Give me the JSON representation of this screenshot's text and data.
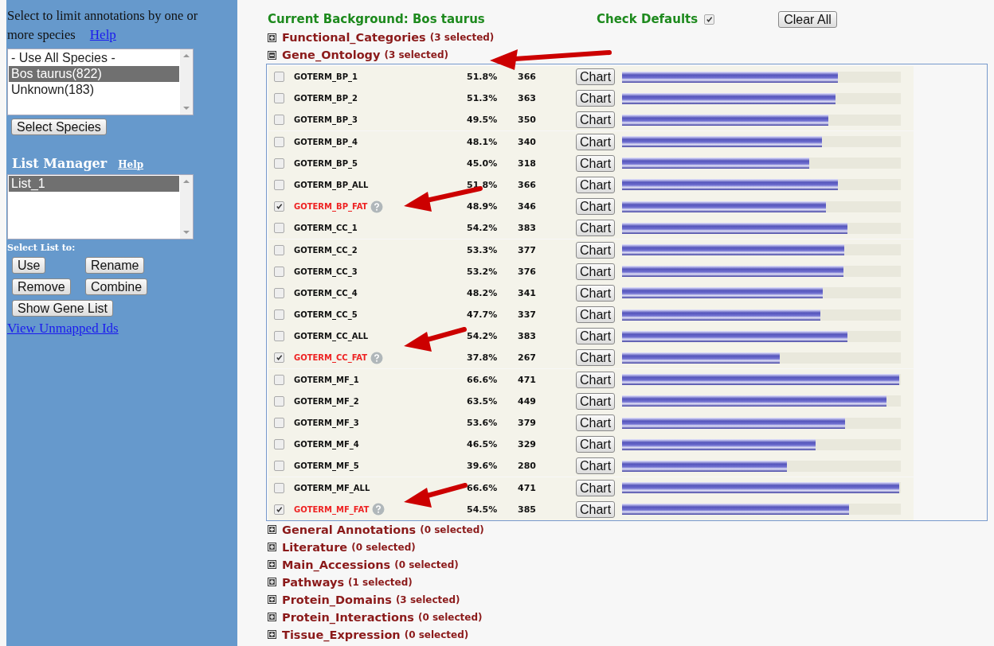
{
  "sidebar": {
    "species_prompt": "Select to limit annotations by one or more species",
    "species_help": "Help",
    "species_list": [
      {
        "label": "- Use All Species -",
        "selected": false
      },
      {
        "label": "Bos taurus(822)",
        "selected": true
      },
      {
        "label": "Unknown(183)",
        "selected": false
      }
    ],
    "select_species_button": "Select Species",
    "list_manager_title": "List Manager",
    "list_manager_help": "Help",
    "lists": [
      {
        "label": "List_1",
        "selected": true
      }
    ],
    "select_list_label": "Select List to:",
    "list_buttons": [
      "Use",
      "Rename",
      "Remove",
      "Combine"
    ],
    "show_gene_list_button": "Show Gene List",
    "unmapped_link": "View Unmapped Ids"
  },
  "header": {
    "background_label": "Current Background: Bos taurus",
    "check_defaults_label": "Check Defaults",
    "check_defaults_checked": true,
    "clear_all_button": "Clear All"
  },
  "sections": [
    {
      "name": "Functional_Categories",
      "count": "(3 selected)",
      "expanded": false
    },
    {
      "name": "Gene_Ontology",
      "count": "(3 selected)",
      "expanded": true,
      "rows": [
        {
          "term": "GOTERM_BP_1",
          "checked": false,
          "percent": "51.8%",
          "count": "366",
          "button": "Chart",
          "level": 0.773
        },
        {
          "term": "GOTERM_BP_2",
          "checked": false,
          "percent": "51.3%",
          "count": "363",
          "button": "Chart",
          "level": 0.766
        },
        {
          "term": "GOTERM_BP_3",
          "checked": false,
          "percent": "49.5%",
          "count": "350",
          "button": "Chart",
          "level": 0.739
        },
        {
          "term": "GOTERM_BP_4",
          "checked": false,
          "percent": "48.1%",
          "count": "340",
          "button": "Chart",
          "level": 0.718
        },
        {
          "term": "GOTERM_BP_5",
          "checked": false,
          "percent": "45.0%",
          "count": "318",
          "button": "Chart",
          "level": 0.672
        },
        {
          "term": "GOTERM_BP_ALL",
          "checked": false,
          "percent": "51.8%",
          "count": "366",
          "button": "Chart",
          "level": 0.773
        },
        {
          "term": "GOTERM_BP_FAT",
          "checked": true,
          "percent": "48.9%",
          "count": "346",
          "button": "Chart",
          "level": 0.73
        },
        {
          "term": "GOTERM_CC_1",
          "checked": false,
          "percent": "54.2%",
          "count": "383",
          "button": "Chart",
          "level": 0.809
        },
        {
          "term": "GOTERM_CC_2",
          "checked": false,
          "percent": "53.3%",
          "count": "377",
          "button": "Chart",
          "level": 0.796
        },
        {
          "term": "GOTERM_CC_3",
          "checked": false,
          "percent": "53.2%",
          "count": "376",
          "button": "Chart",
          "level": 0.794
        },
        {
          "term": "GOTERM_CC_4",
          "checked": false,
          "percent": "48.2%",
          "count": "341",
          "button": "Chart",
          "level": 0.719
        },
        {
          "term": "GOTERM_CC_5",
          "checked": false,
          "percent": "47.7%",
          "count": "337",
          "button": "Chart",
          "level": 0.712
        },
        {
          "term": "GOTERM_CC_ALL",
          "checked": false,
          "percent": "54.2%",
          "count": "383",
          "button": "Chart",
          "level": 0.809
        },
        {
          "term": "GOTERM_CC_FAT",
          "checked": true,
          "percent": "37.8%",
          "count": "267",
          "button": "Chart",
          "level": 0.564
        },
        {
          "term": "GOTERM_MF_1",
          "checked": false,
          "percent": "66.6%",
          "count": "471",
          "button": "Chart",
          "level": 0.994
        },
        {
          "term": "GOTERM_MF_2",
          "checked": false,
          "percent": "63.5%",
          "count": "449",
          "button": "Chart",
          "level": 0.948
        },
        {
          "term": "GOTERM_MF_3",
          "checked": false,
          "percent": "53.6%",
          "count": "379",
          "button": "Chart",
          "level": 0.8
        },
        {
          "term": "GOTERM_MF_4",
          "checked": false,
          "percent": "46.5%",
          "count": "329",
          "button": "Chart",
          "level": 0.694
        },
        {
          "term": "GOTERM_MF_5",
          "checked": false,
          "percent": "39.6%",
          "count": "280",
          "button": "Chart",
          "level": 0.591
        },
        {
          "term": "GOTERM_MF_ALL",
          "checked": false,
          "percent": "66.6%",
          "count": "471",
          "button": "Chart",
          "level": 0.994
        },
        {
          "term": "GOTERM_MF_FAT",
          "checked": true,
          "percent": "54.5%",
          "count": "385",
          "button": "Chart",
          "level": 0.813
        }
      ]
    },
    {
      "name": "General Annotations",
      "count": "(0 selected)",
      "expanded": false
    },
    {
      "name": "Literature",
      "count": "(0 selected)",
      "expanded": false
    },
    {
      "name": "Main_Accessions",
      "count": "(0 selected)",
      "expanded": false
    },
    {
      "name": "Pathways",
      "count": "(1 selected)",
      "expanded": false
    },
    {
      "name": "Protein_Domains",
      "count": "(3 selected)",
      "expanded": false
    },
    {
      "name": "Protein_Interactions",
      "count": "(0 selected)",
      "expanded": false
    },
    {
      "name": "Tissue_Expression",
      "count": "(0 selected)",
      "expanded": false
    }
  ]
}
